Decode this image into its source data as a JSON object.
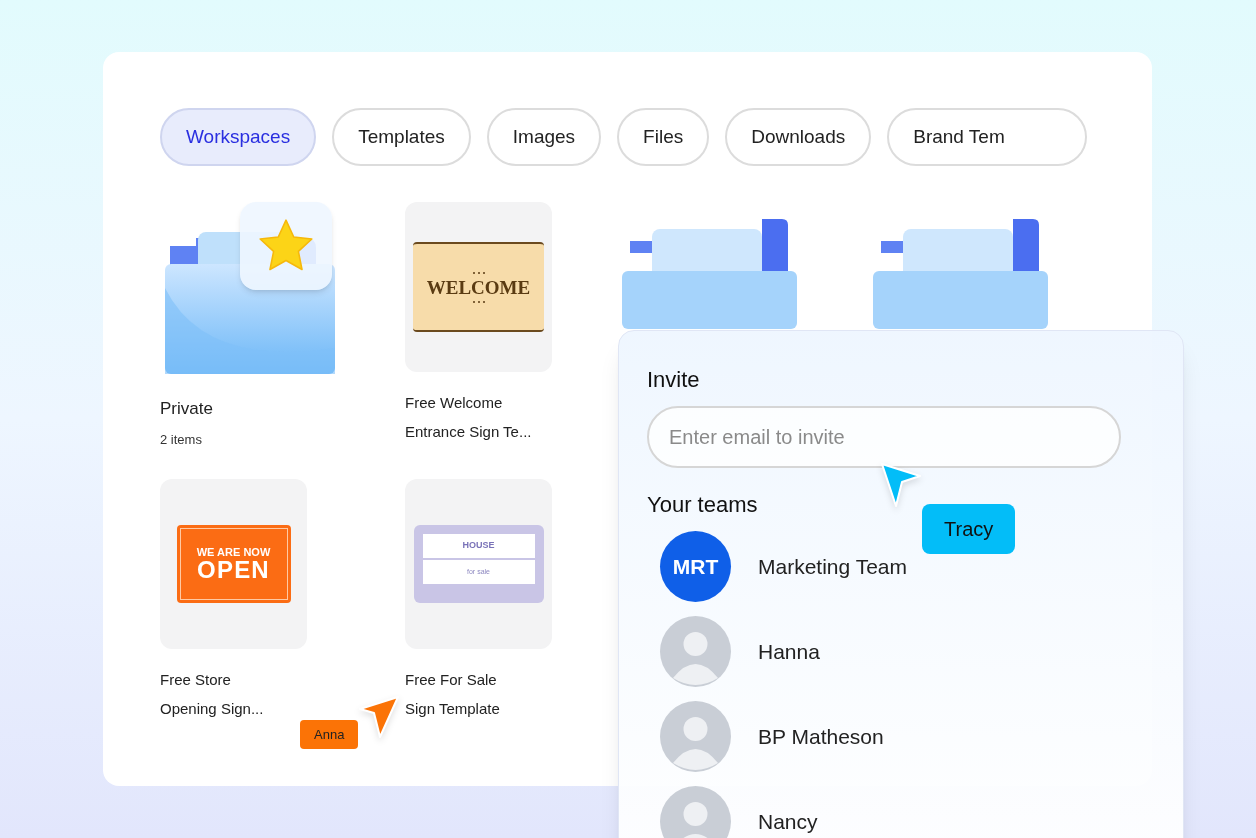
{
  "tabs": [
    {
      "label": "Workspaces",
      "selected": true
    },
    {
      "label": "Templates",
      "selected": false
    },
    {
      "label": "Images",
      "selected": false
    },
    {
      "label": "Files",
      "selected": false
    },
    {
      "label": "Downloads",
      "selected": false
    },
    {
      "label": "Brand Tem",
      "selected": false
    }
  ],
  "items": [
    {
      "kind": "starred_folder",
      "title": "Private",
      "subtitle": "2 items"
    },
    {
      "kind": "welcome_sign",
      "sign_text": "WELCOME",
      "title_lines": [
        "Free Welcome",
        "Entrance Sign Te..."
      ]
    },
    {
      "kind": "folder"
    },
    {
      "kind": "folder"
    },
    {
      "kind": "open_sign",
      "sign_lines": [
        "WE ARE NOW",
        "OPEN"
      ],
      "title_lines": [
        "Free Store",
        "Opening Sign..."
      ]
    },
    {
      "kind": "sale_sign",
      "sign_lines": [
        "HOUSE",
        "for sale"
      ],
      "title_lines": [
        "Free For Sale",
        "Sign Template"
      ]
    }
  ],
  "invite_panel": {
    "title": "Invite",
    "email_field": {
      "placeholder": "Enter email to invite"
    },
    "teams_heading": "Your teams",
    "teams": [
      {
        "kind": "initials",
        "initials": "MRT",
        "name": "Marketing Team"
      },
      {
        "kind": "photo",
        "name": "Hanna"
      },
      {
        "kind": "photo",
        "name": "BP Matheson"
      },
      {
        "kind": "photo",
        "name": "Nancy"
      }
    ]
  },
  "cursors": [
    {
      "name": "Anna",
      "color": "#fb7306"
    },
    {
      "name": "Tracy",
      "color": "#03bdf8"
    }
  ]
}
